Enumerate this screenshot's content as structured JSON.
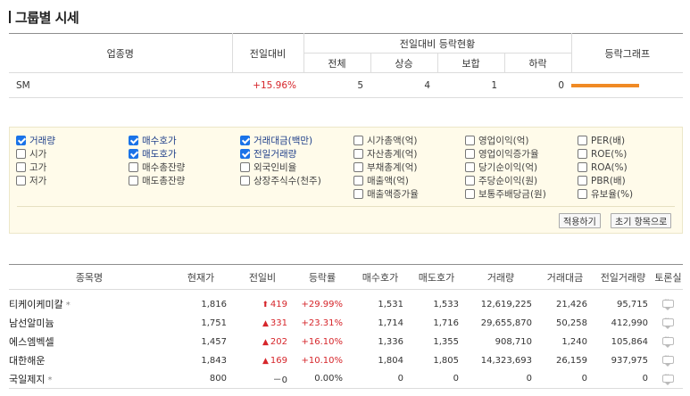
{
  "title": "그룹별 시세",
  "group_table": {
    "headers": {
      "name": "업종명",
      "change": "전일대비",
      "updown": "전일대비 등락현황",
      "total": "전체",
      "up": "상승",
      "flat": "보합",
      "down": "하락",
      "graph": "등락그래프"
    },
    "row": {
      "name": "SM",
      "change": "+15.96%",
      "total": "5",
      "up": "4",
      "flat": "1",
      "down": "0",
      "graph_up_ratio": 0.8
    }
  },
  "options": [
    {
      "label": "거래량",
      "checked": true
    },
    {
      "label": "시가",
      "checked": false
    },
    {
      "label": "고가",
      "checked": false
    },
    {
      "label": "저가",
      "checked": false
    },
    {
      "label": "매수호가",
      "checked": true
    },
    {
      "label": "매도호가",
      "checked": true
    },
    {
      "label": "매수총잔량",
      "checked": false
    },
    {
      "label": "매도총잔량",
      "checked": false
    },
    {
      "label": "거래대금(백만)",
      "checked": true
    },
    {
      "label": "전일거래량",
      "checked": true
    },
    {
      "label": "외국인비율",
      "checked": false
    },
    {
      "label": "상장주식수(천주)",
      "checked": false
    },
    {
      "label": "시가총액(억)",
      "checked": false
    },
    {
      "label": "자산총계(억)",
      "checked": false
    },
    {
      "label": "부채총계(억)",
      "checked": false
    },
    {
      "label": "매출액(억)",
      "checked": false
    },
    {
      "label": "매출액증가율",
      "checked": false
    },
    {
      "label": "영업이익(억)",
      "checked": false
    },
    {
      "label": "영업이익증가율",
      "checked": false
    },
    {
      "label": "당기순이익(억)",
      "checked": false
    },
    {
      "label": "주당순이익(원)",
      "checked": false
    },
    {
      "label": "보통주배당금(원)",
      "checked": false
    },
    {
      "label": "PER(배)",
      "checked": false
    },
    {
      "label": "ROE(%)",
      "checked": false
    },
    {
      "label": "ROA(%)",
      "checked": false
    },
    {
      "label": "PBR(배)",
      "checked": false
    },
    {
      "label": "유보율(%)",
      "checked": false
    }
  ],
  "buttons": {
    "apply": "적용하기",
    "reset": "초기 항목으로"
  },
  "stock_table": {
    "headers": {
      "name": "종목명",
      "price": "현재가",
      "change": "전일비",
      "rate": "등락률",
      "bid": "매수호가",
      "ask": "매도호가",
      "volume": "거래량",
      "amount": "거래대금",
      "prev_volume": "전일거래량",
      "talk": "토론실"
    },
    "rows": [
      {
        "name": "티케이케미칼",
        "star": "*",
        "price": "1,816",
        "arrow": "⬆",
        "change": "419",
        "rate": "+29.99%",
        "bid": "1,531",
        "ask": "1,533",
        "volume": "12,619,225",
        "amount": "21,426",
        "prev_volume": "95,715"
      },
      {
        "name": "남선알미늄",
        "star": "",
        "price": "1,751",
        "arrow": "▲",
        "change": "331",
        "rate": "+23.31%",
        "bid": "1,714",
        "ask": "1,716",
        "volume": "29,655,870",
        "amount": "50,258",
        "prev_volume": "412,990"
      },
      {
        "name": "에스엠벡셀",
        "star": "",
        "price": "1,457",
        "arrow": "▲",
        "change": "202",
        "rate": "+16.10%",
        "bid": "1,336",
        "ask": "1,355",
        "volume": "908,710",
        "amount": "1,240",
        "prev_volume": "105,864"
      },
      {
        "name": "대한해운",
        "star": "",
        "price": "1,843",
        "arrow": "▲",
        "change": "169",
        "rate": "+10.10%",
        "bid": "1,804",
        "ask": "1,805",
        "volume": "14,323,693",
        "amount": "26,159",
        "prev_volume": "937,975"
      },
      {
        "name": "국일제지",
        "star": "*",
        "price": "800",
        "arrow": "",
        "change": "－0",
        "rate": "0.00%",
        "bid": "0",
        "ask": "0",
        "volume": "0",
        "amount": "0",
        "prev_volume": "0"
      }
    ]
  },
  "colors": {
    "up": "#d6262b",
    "graph_bar": "#f08a24",
    "checkbox": "#1a73e8",
    "options_bg": "#fffbea"
  }
}
